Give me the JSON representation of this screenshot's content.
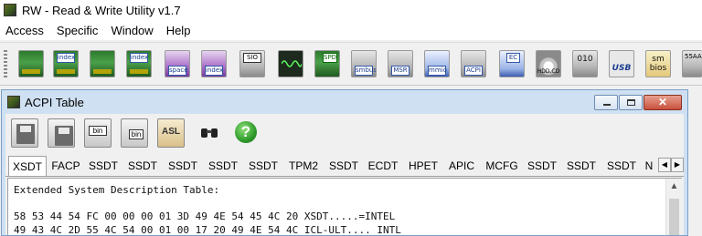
{
  "app": {
    "title": "RW - Read & Write Utility v1.7"
  },
  "menu": [
    "Access",
    "Specific",
    "Window",
    "Help"
  ],
  "toolbar": {
    "buttons": [
      {
        "name": "pci-button",
        "icon": "pci-card-icon",
        "label": ""
      },
      {
        "name": "pci-index-button",
        "icon": "pci-index-icon",
        "label": "index"
      },
      {
        "name": "memory-button",
        "icon": "memory-module-icon",
        "label": ""
      },
      {
        "name": "memory-index-button",
        "icon": "memory-index-icon",
        "label": "index"
      },
      {
        "name": "io-space-button",
        "icon": "io-space-icon",
        "label": "space"
      },
      {
        "name": "io-index-button",
        "icon": "io-index-icon",
        "label": "index"
      },
      {
        "name": "superio-button",
        "icon": "superio-icon",
        "label": "SIO"
      },
      {
        "name": "oscilloscope-button",
        "icon": "oscilloscope-icon",
        "label": ""
      },
      {
        "name": "spd-button",
        "icon": "spd-icon",
        "label": "SPD"
      },
      {
        "name": "smbus-button",
        "icon": "smbus-icon",
        "label": "smbus"
      },
      {
        "name": "msr-button",
        "icon": "msr-icon",
        "label": "MSR"
      },
      {
        "name": "mmio-button",
        "icon": "mmio-icon",
        "label": "mmio"
      },
      {
        "name": "acpi-button",
        "icon": "acpi-icon",
        "label": "ACPI"
      },
      {
        "name": "ec-button",
        "icon": "ec-icon",
        "label": "EC"
      },
      {
        "name": "hdd-cd-button",
        "icon": "hdd-cd-icon",
        "label": "HDD,CD"
      },
      {
        "name": "file-010-button",
        "icon": "file-010-icon",
        "label": "010"
      },
      {
        "name": "usb-button",
        "icon": "usb-icon",
        "label": "USB"
      },
      {
        "name": "smbios-button",
        "icon": "smbios-icon",
        "label": "sm bios"
      },
      {
        "name": "55aa-button",
        "icon": "rom-55aa-icon",
        "label": "55AA"
      }
    ]
  },
  "child_window": {
    "title": "ACPI Table",
    "toolbar": [
      {
        "name": "save-button",
        "icon": "floppy-disk-icon"
      },
      {
        "name": "save-all-button",
        "icon": "floppy-stack-icon"
      },
      {
        "name": "save-bin-button",
        "icon": "bin-disk-icon",
        "label": "bin"
      },
      {
        "name": "save-all-bin-button",
        "icon": "bin-stack-icon",
        "label": "bin"
      },
      {
        "name": "asl-button",
        "icon": "asl-icon",
        "label": "ASL"
      },
      {
        "name": "find-button",
        "icon": "binoculars-icon"
      },
      {
        "name": "help-button",
        "icon": "help-icon",
        "label": "?"
      }
    ],
    "tabs": [
      "XSDT",
      "FACP",
      "SSDT",
      "SSDT",
      "SSDT",
      "SSDT",
      "SSDT",
      "TPM2",
      "SSDT",
      "ECDT",
      "HPET",
      "APIC",
      "MCFG",
      "SSDT",
      "SSDT",
      "SSDT",
      "N"
    ],
    "active_tab": "XSDT",
    "content": {
      "heading": "Extended System Description Table:",
      "lines": [
        "58 53 44 54 FC 00 00 00 01 3D 49 4E 54 45 4C 20 XSDT.....=INTEL",
        "49 43 4C 2D 55 4C 54 00 01 00 17 20 49 4E 54 4C ICL-ULT.... INTL"
      ]
    }
  },
  "colors": {
    "child_frame": "#cfe0f2",
    "close_button": "#c8503c"
  }
}
